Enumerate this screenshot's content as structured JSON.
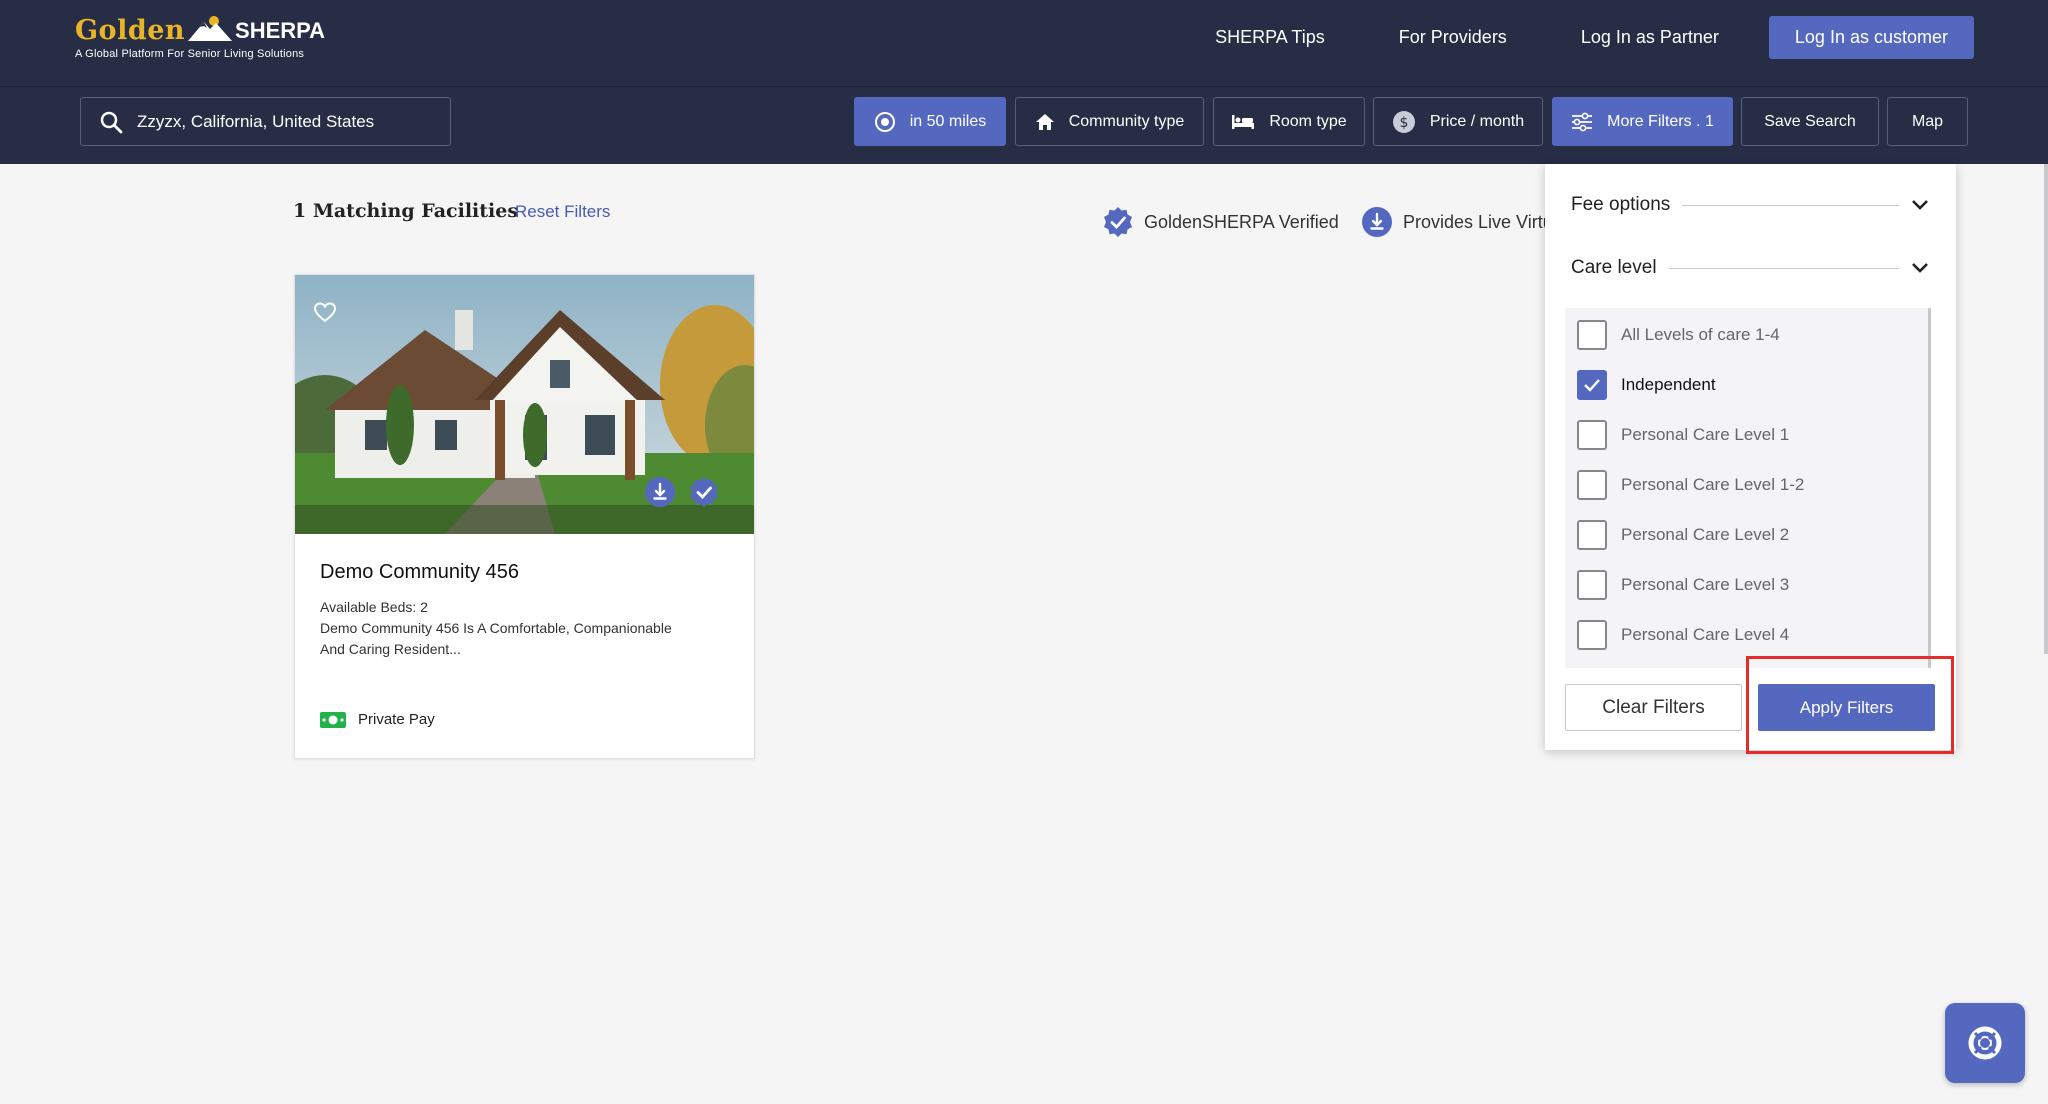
{
  "brand": {
    "name_golden": "Golden",
    "name_sherpa": "SHERPA",
    "tagline": "A Global Platform For Senior Living Solutions"
  },
  "nav": {
    "items": [
      "SHERPA Tips",
      "For Providers",
      "Log In as Partner"
    ],
    "cta": "Log In as customer"
  },
  "search": {
    "value": "Zzyzx, California, United States"
  },
  "filters": {
    "radius": "in 50 miles",
    "community": "Community type",
    "room": "Room type",
    "price": "Price / month",
    "more": "More Filters . 1",
    "save": "Save Search",
    "map": "Map"
  },
  "results": {
    "title": "1 Matching Facilities",
    "reset": "Reset Filters"
  },
  "legend": {
    "verified": "GoldenSHERPA Verified",
    "live": "Provides Live Virtu"
  },
  "card": {
    "title": "Demo Community 456",
    "beds": "Available Beds: 2",
    "desc_line1": "Demo Community 456 Is A Comfortable, Companionable",
    "desc_line2": "And Caring Resident...",
    "fee": "Private Pay"
  },
  "panel": {
    "fee_options": "Fee options",
    "care_level": "Care level",
    "options": [
      {
        "label": "All Levels of care 1-4",
        "checked": false
      },
      {
        "label": "Independent",
        "checked": true
      },
      {
        "label": "Personal Care Level 1",
        "checked": false
      },
      {
        "label": "Personal Care Level 1-2",
        "checked": false
      },
      {
        "label": "Personal Care Level 2",
        "checked": false
      },
      {
        "label": "Personal Care Level 3",
        "checked": false
      },
      {
        "label": "Personal Care Level 4",
        "checked": false
      }
    ],
    "clear": "Clear Filters",
    "apply": "Apply Filters"
  },
  "colors": {
    "navy": "#262d45",
    "accent": "#5568c0",
    "gold": "#e9b527",
    "highlight": "#e62b2b"
  }
}
